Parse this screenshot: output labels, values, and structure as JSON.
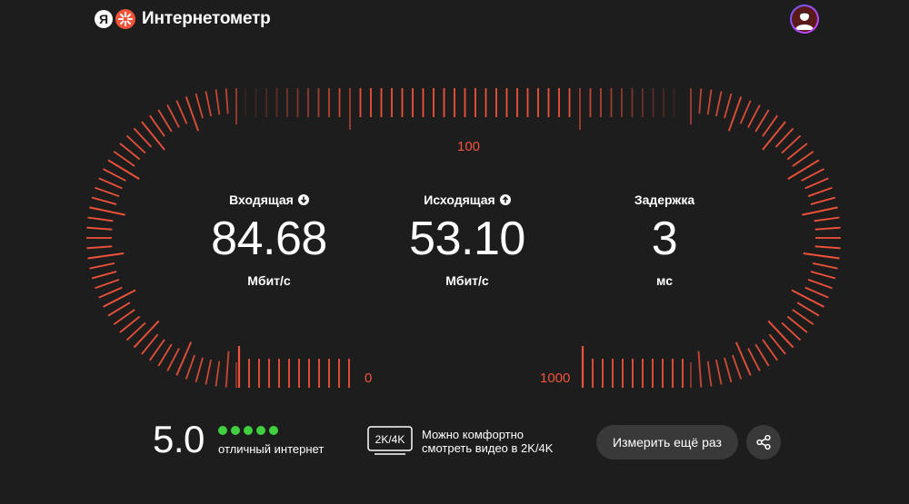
{
  "header": {
    "logo_letter": "Я",
    "app_name": "Интернетометр"
  },
  "gauge": {
    "accent_color": "#f0523a",
    "labels": {
      "top": "100",
      "bottom_left": "0",
      "bottom_right": "1000"
    }
  },
  "metrics": [
    {
      "title": "Входящая",
      "value": "84.68",
      "unit": "Мбит/с",
      "icon": "download-icon"
    },
    {
      "title": "Исходящая",
      "value": "53.10",
      "unit": "Мбит/с",
      "icon": "upload-icon"
    },
    {
      "title": "Задержка",
      "value": "3",
      "unit": "мс"
    }
  ],
  "rating": {
    "score": "5.0",
    "dots_filled": 5,
    "dots_total": 5,
    "dot_color": "#3fcf3f",
    "text": "отличный интернет"
  },
  "quality": {
    "badge": "2K/4K",
    "line1": "Можно комфортно",
    "line2": "смотреть видео в 2K/4K"
  },
  "actions": {
    "retry_label": "Измерить ещё раз",
    "share_icon": "share-icon"
  }
}
